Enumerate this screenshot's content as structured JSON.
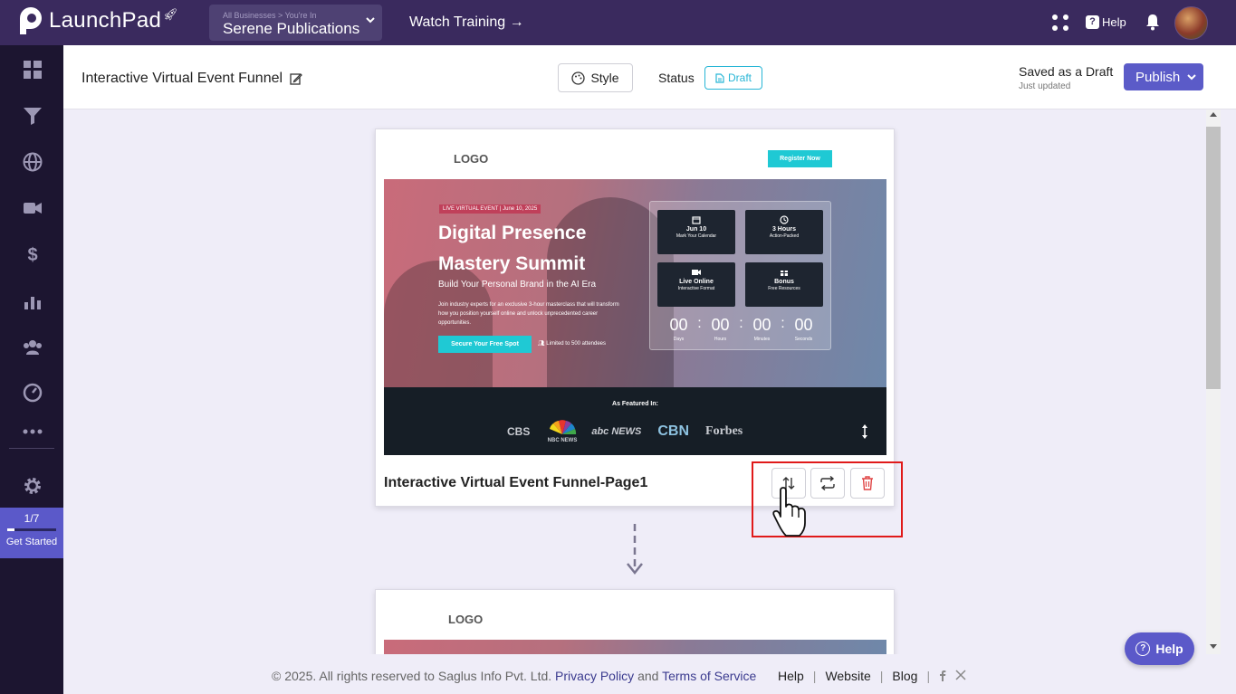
{
  "app": {
    "name": "LaunchPad",
    "business_context": "All Businesses > You're In",
    "business_name": "Serene Publications",
    "watch_training": "Watch Training →",
    "help_label": "Help"
  },
  "sidebar": {
    "icons": [
      "dashboard-icon",
      "funnel-icon",
      "globe-icon",
      "video-icon",
      "dollar-icon",
      "analytics-icon",
      "users-icon",
      "gauge-icon",
      "more-icon",
      "settings-icon"
    ],
    "get_started": {
      "count": "1/7",
      "progress": 0.14,
      "label": "Get Started"
    }
  },
  "header": {
    "title": "Interactive Virtual Event Funnel",
    "style_label": "Style",
    "status_label": "Status",
    "status_value": "Draft",
    "saved_text": "Saved as a Draft",
    "updated_text": "Just updated",
    "publish_label": "Publish"
  },
  "page_card": {
    "logo": "LOGO",
    "register_button": "Register Now",
    "event_tag": "LIVE VIRTUAL EVENT | June 10, 2025",
    "hero_title": "Digital Presence Mastery Summit",
    "hero_subtitle": "Build Your Personal Brand in the AI Era",
    "hero_description": "Join industry experts for an exclusive 3-hour masterclass that will transform how you position yourself online and unlock unprecedented career opportunities.",
    "cta_button": "Secure Your Free Spot",
    "limited_text": "Limited to 500 attendees",
    "tiles": [
      {
        "icon": "calendar-icon",
        "title": "Jun 10",
        "sub": "Mark Your Calendar"
      },
      {
        "icon": "clock-icon",
        "title": "3 Hours",
        "sub": "Action-Packed"
      },
      {
        "icon": "video-icon",
        "title": "Live Online",
        "sub": "Interactive Format"
      },
      {
        "icon": "gift-icon",
        "title": "Bonus",
        "sub": "Free Resources"
      }
    ],
    "countdown": [
      {
        "value": "00",
        "label": "Days"
      },
      {
        "value": "00",
        "label": "Hours"
      },
      {
        "value": "00",
        "label": "Minutes"
      },
      {
        "value": "00",
        "label": "Seconds"
      }
    ],
    "featured_title": "As Featured In:",
    "brands": [
      "CBS",
      "NBC NEWS",
      "abc NEWS",
      "CBN",
      "Forbes"
    ],
    "page_name": "Interactive Virtual Event Funnel-Page1"
  },
  "page_card_2": {
    "logo": "LOGO"
  },
  "footer": {
    "copyright": "©  2025. All rights reserved to Saglus Info Pvt. Ltd.",
    "privacy": "Privacy Policy",
    "and": "and",
    "terms": "Terms of Service",
    "links": [
      "Help",
      "Website",
      "Blog"
    ]
  },
  "floating_help": "Help",
  "colors": {
    "topbar": "#3a2a5e",
    "sidebar": "#1c1530",
    "accent": "#5b5bc8",
    "draft": "#28b6d6",
    "highlight": "#e01a1a"
  }
}
